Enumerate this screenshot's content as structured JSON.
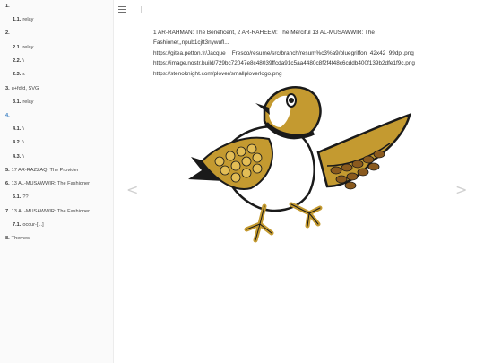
{
  "sidebar": {
    "items": [
      {
        "num": "1.",
        "label": "",
        "level": 0
      },
      {
        "num": "1.1.",
        "label": "relay",
        "level": 1
      },
      {
        "num": "2.",
        "label": "",
        "level": 0
      },
      {
        "num": "2.1.",
        "label": "relay",
        "level": 1
      },
      {
        "num": "2.2.",
        "label": "\\",
        "level": 1
      },
      {
        "num": "2.3.",
        "label": "ε",
        "level": 1
      },
      {
        "num": "3.",
        "label": "u+fdfd, SVG",
        "level": 0
      },
      {
        "num": "3.1.",
        "label": "relay",
        "level": 1
      },
      {
        "num": "4.",
        "label": "",
        "level": 0,
        "active": true
      },
      {
        "num": "4.1.",
        "label": "\\",
        "level": 1
      },
      {
        "num": "4.2.",
        "label": "\\",
        "level": 1
      },
      {
        "num": "4.3.",
        "label": "\\",
        "level": 1
      },
      {
        "num": "5.",
        "label": "17 AR-RAZZAQ: The Provider",
        "level": 0
      },
      {
        "num": "6.",
        "label": "13 AL-MUSAWWIR: The Fashioner",
        "level": 0
      },
      {
        "num": "6.1.",
        "label": "??",
        "level": 1
      },
      {
        "num": "7.",
        "label": "13 AL-MUSAWWIR: The Fashioner",
        "level": 0
      },
      {
        "num": "7.1.",
        "label": "occur-[...]",
        "level": 1
      },
      {
        "num": "8.",
        "label": "Themes",
        "level": 0
      }
    ]
  },
  "toolbar": {
    "menu_icon": "hamburger-icon",
    "search_icon": "search-icon"
  },
  "content": {
    "lines": [
      "1 AR-RAHMAN: The Beneficent, 2 AR-RAHEEM: The Merciful 13 AL-MUSAWWIR: The",
      "Fashioner,,npub1cjtt3nywufl...",
      "https://gitea.petton.fr/Jacque__Fresco/resume/src/branch/resum%c3%a9/bluegriffon_42x42_99dpi.png",
      "https://image.nostr.build/729bc72047e8c48039ffcda91c5aa4480c8f2f4f48c6cddb400f139b2dfe1f9c.png",
      "https://stenoknight.com/plover/smallploverlogo.png"
    ],
    "image_alt": "plover bird logo"
  },
  "nav": {
    "prev": "<",
    "next": ">"
  },
  "colors": {
    "accent": "#4183c4",
    "bird_gold": "#c49a30",
    "bird_dark": "#1a1a1a",
    "bird_brown": "#8a5a1e"
  }
}
